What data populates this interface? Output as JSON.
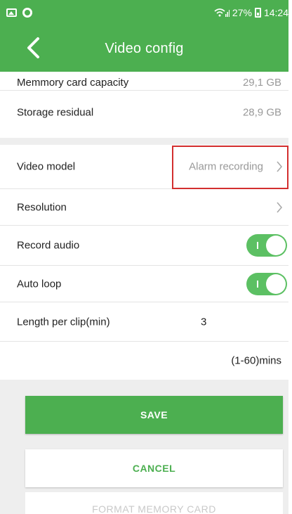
{
  "status_bar": {
    "battery": "27%",
    "time": "14:24"
  },
  "app_bar": {
    "title": "Video config"
  },
  "settings": {
    "card_capacity": {
      "label": "Memmory card capacity",
      "value": "29,1 GB"
    },
    "storage_residual": {
      "label": "Storage residual",
      "value": "28,9 GB"
    },
    "video_model": {
      "label": "Video model",
      "value": "Alarm recording"
    },
    "resolution": {
      "label": "Resolution"
    },
    "record_audio": {
      "label": "Record audio",
      "enabled": true
    },
    "auto_loop": {
      "label": "Auto loop",
      "enabled": true
    },
    "clip_length": {
      "label": "Length per clip(min)",
      "value": "3",
      "range": "(1-60)mins"
    }
  },
  "actions": {
    "save": "SAVE",
    "cancel": "CANCEL",
    "format": "FORMAT MEMORY CARD"
  },
  "colors": {
    "primary": "#4caf50",
    "toggle_on": "#5cc063",
    "highlight": "#d32f2f"
  }
}
